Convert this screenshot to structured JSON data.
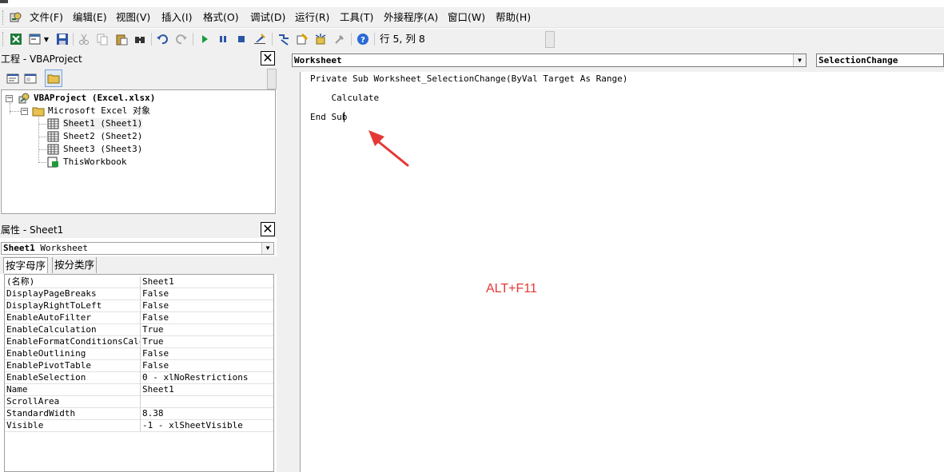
{
  "menu": {
    "items": [
      "文件(F)",
      "编辑(E)",
      "视图(V)",
      "插入(I)",
      "格式(O)",
      "调试(D)",
      "运行(R)",
      "工具(T)",
      "外接程序(A)",
      "窗口(W)",
      "帮助(H)"
    ]
  },
  "toolbar": {
    "icons": [
      "excel-icon",
      "insert-userform-icon",
      "save-icon",
      "cut-icon",
      "copy-icon",
      "paste-icon",
      "find-icon",
      "undo-icon",
      "redo-icon",
      "run-icon",
      "break-icon",
      "reset-icon",
      "design-mode-icon",
      "project-explorer-icon",
      "properties-window-icon",
      "object-browser-icon",
      "toolbox-icon",
      "help-icon"
    ],
    "status": "行 5, 列 8"
  },
  "project": {
    "title": "工程 - VBAProject",
    "root": "VBAProject (Excel.xlsx)",
    "folder": "Microsoft Excel 对象",
    "items": [
      "Sheet1 (Sheet1)",
      "Sheet2 (Sheet2)",
      "Sheet3 (Sheet3)",
      "ThisWorkbook"
    ],
    "selected": "Sheet1 (Sheet1)"
  },
  "properties": {
    "title": "属性 - Sheet1",
    "object_name": "Sheet1",
    "object_type": "Worksheet",
    "tabs": [
      "按字母序",
      "按分类序"
    ],
    "active_tab": "按字母序",
    "rows": [
      {
        "name": "(名称)",
        "value": "Sheet1"
      },
      {
        "name": "DisplayPageBreaks",
        "value": "False"
      },
      {
        "name": "DisplayRightToLeft",
        "value": "False"
      },
      {
        "name": "EnableAutoFilter",
        "value": "False"
      },
      {
        "name": "EnableCalculation",
        "value": "True"
      },
      {
        "name": "EnableFormatConditionsCalcul",
        "value": "True"
      },
      {
        "name": "EnableOutlining",
        "value": "False"
      },
      {
        "name": "EnablePivotTable",
        "value": "False"
      },
      {
        "name": "EnableSelection",
        "value": "0 - xlNoRestrictions"
      },
      {
        "name": "Name",
        "value": "Sheet1"
      },
      {
        "name": "ScrollArea",
        "value": ""
      },
      {
        "name": "StandardWidth",
        "value": "8.38"
      },
      {
        "name": "Visible",
        "value": "-1 - xlSheetVisible"
      }
    ]
  },
  "code": {
    "object_combo": "Worksheet",
    "procedure_combo": "SelectionChange",
    "lines": [
      "Private Sub Worksheet_SelectionChange(ByVal Target As Range)",
      "    Calculate",
      "End Sub"
    ]
  },
  "annotation": {
    "text": "ALT+F11",
    "color": "#e53935"
  }
}
